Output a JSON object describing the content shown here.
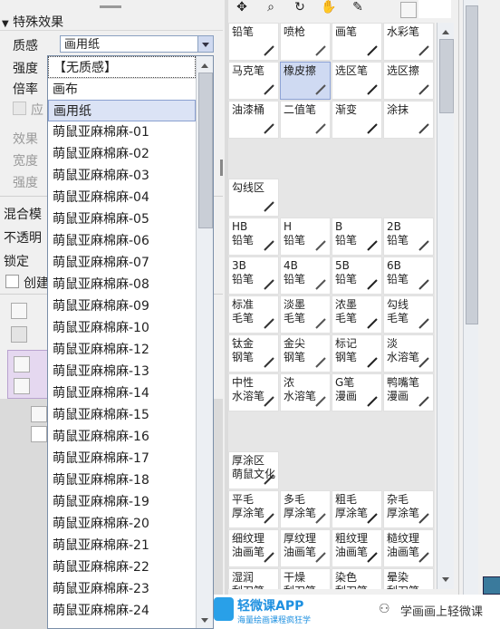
{
  "left": {
    "section_title": "特殊效果",
    "texture_label": "质感",
    "texture_value": "画用纸",
    "strength_label": "强度",
    "scale_label": "倍率",
    "apply_partial": "应",
    "effect_label": "效果",
    "width_label": "宽度",
    "strength2_label": "强度",
    "blend_label": "混合模",
    "opacity_label": "不透明",
    "lock_label": "锁定",
    "create_label": "创建"
  },
  "dropdown": {
    "options": [
      "【无质感】",
      "画布",
      "画用纸",
      "萌鼠亚麻棉麻-01",
      "萌鼠亚麻棉麻-02",
      "萌鼠亚麻棉麻-03",
      "萌鼠亚麻棉麻-04",
      "萌鼠亚麻棉麻-05",
      "萌鼠亚麻棉麻-06",
      "萌鼠亚麻棉麻-07",
      "萌鼠亚麻棉麻-08",
      "萌鼠亚麻棉麻-09",
      "萌鼠亚麻棉麻-10",
      "萌鼠亚麻棉麻-12",
      "萌鼠亚麻棉麻-13",
      "萌鼠亚麻棉麻-14",
      "萌鼠亚麻棉麻-15",
      "萌鼠亚麻棉麻-16",
      "萌鼠亚麻棉麻-17",
      "萌鼠亚麻棉麻-18",
      "萌鼠亚麻棉麻-19",
      "萌鼠亚麻棉麻-20",
      "萌鼠亚麻棉麻-21",
      "萌鼠亚麻棉麻-22",
      "萌鼠亚麻棉麻-23",
      "萌鼠亚麻棉麻-24"
    ],
    "selected": "画用纸"
  },
  "tools": {
    "rows": [
      [
        {
          "l1": "铅笔",
          "l2": ""
        },
        {
          "l1": "喷枪",
          "l2": ""
        },
        {
          "l1": "画笔",
          "l2": ""
        },
        {
          "l1": "水彩笔",
          "l2": ""
        }
      ],
      [
        {
          "l1": "马克笔",
          "l2": ""
        },
        {
          "l1": "橡皮擦",
          "l2": "",
          "sel": true
        },
        {
          "l1": "选区笔",
          "l2": ""
        },
        {
          "l1": "选区擦",
          "l2": ""
        }
      ],
      [
        {
          "l1": "油漆桶",
          "l2": ""
        },
        {
          "l1": "二值笔",
          "l2": ""
        },
        {
          "l1": "渐变",
          "l2": ""
        },
        {
          "l1": "涂抹",
          "l2": ""
        }
      ],
      "empty",
      [
        {
          "l1": "勾线区",
          "l2": ""
        }
      ],
      [
        {
          "l1": "HB",
          "l2": "铅笔"
        },
        {
          "l1": "H",
          "l2": "铅笔"
        },
        {
          "l1": "B",
          "l2": "铅笔"
        },
        {
          "l1": "2B",
          "l2": "铅笔"
        }
      ],
      [
        {
          "l1": "3B",
          "l2": "铅笔"
        },
        {
          "l1": "4B",
          "l2": "铅笔"
        },
        {
          "l1": "5B",
          "l2": "铅笔"
        },
        {
          "l1": "6B",
          "l2": "铅笔"
        }
      ],
      [
        {
          "l1": "标准",
          "l2": "毛笔"
        },
        {
          "l1": "淡墨",
          "l2": "毛笔"
        },
        {
          "l1": "浓墨",
          "l2": "毛笔"
        },
        {
          "l1": "勾线",
          "l2": "毛笔"
        }
      ],
      [
        {
          "l1": "钛金",
          "l2": "钢笔"
        },
        {
          "l1": "金尖",
          "l2": "钢笔"
        },
        {
          "l1": "标记",
          "l2": "钢笔"
        },
        {
          "l1": "淡",
          "l2": "水溶笔"
        }
      ],
      [
        {
          "l1": "中性",
          "l2": "水溶笔"
        },
        {
          "l1": "浓",
          "l2": "水溶笔"
        },
        {
          "l1": "G笔",
          "l2": "漫画"
        },
        {
          "l1": "鸭嘴笔",
          "l2": "漫画"
        }
      ],
      "empty",
      [
        {
          "l1": "厚涂区",
          "l2": "萌鼠文化"
        }
      ],
      [
        {
          "l1": "平毛",
          "l2": "厚涂笔"
        },
        {
          "l1": "多毛",
          "l2": "厚涂笔"
        },
        {
          "l1": "粗毛",
          "l2": "厚涂笔"
        },
        {
          "l1": "杂毛",
          "l2": "厚涂笔"
        }
      ],
      [
        {
          "l1": "细纹理",
          "l2": "油画笔"
        },
        {
          "l1": "厚纹理",
          "l2": "油画笔"
        },
        {
          "l1": "粗纹理",
          "l2": "油画笔"
        },
        {
          "l1": "糙纹理",
          "l2": "油画笔"
        }
      ],
      [
        {
          "l1": "湿润",
          "l2": "刮刀笔"
        },
        {
          "l1": "干燥",
          "l2": "刮刀笔"
        },
        {
          "l1": "染色",
          "l2": "刮刀笔"
        },
        {
          "l1": "晕染",
          "l2": "刮刀笔"
        }
      ]
    ]
  },
  "watermark": {
    "app_name": "轻微课APP",
    "app_sub": "海量绘画课程疯狂学",
    "account": "学画画上轻微课"
  },
  "colors": {
    "selection": "#cfdaf2",
    "accent": "#8ea3d6"
  }
}
